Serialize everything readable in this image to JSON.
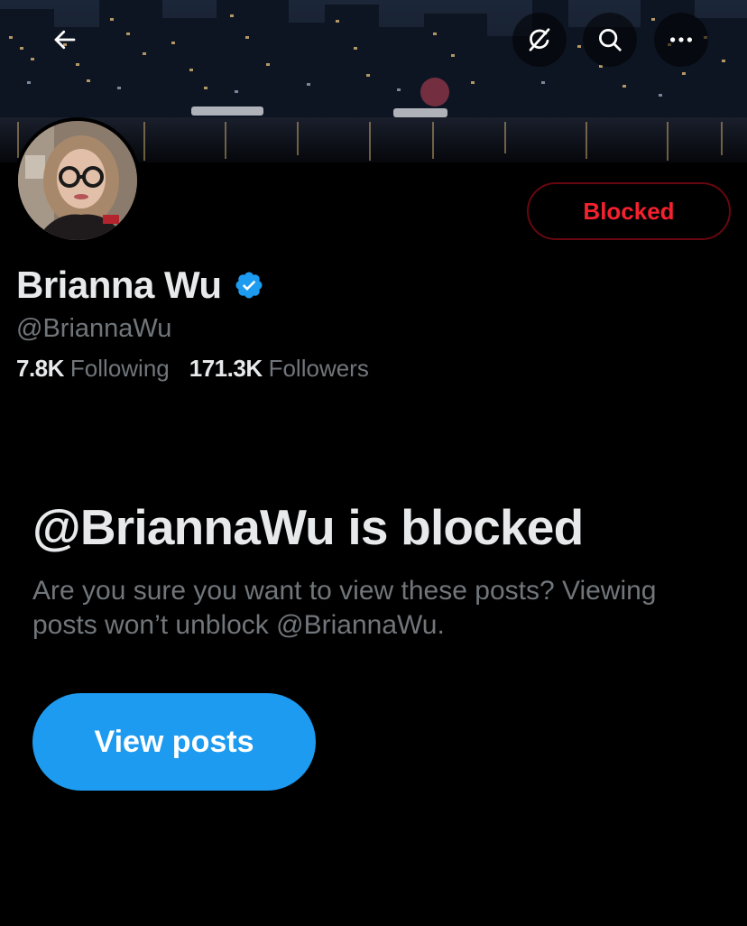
{
  "header": {
    "back_icon": "arrow-left-icon",
    "grok_icon": "grok-icon",
    "search_icon": "search-icon",
    "more_icon": "more-horizontal-icon"
  },
  "profile": {
    "display_name": "Brianna Wu",
    "handle": "@BriannaWu",
    "verified": true,
    "following_count": "7.8K",
    "following_label": "Following",
    "followers_count": "171.3K",
    "followers_label": "Followers",
    "blocked_button_label": "Blocked"
  },
  "blocked_notice": {
    "title": "@BriannaWu is blocked",
    "description": "Are you sure you want to view these posts? Viewing posts won’t unblock @BriannaWu.",
    "view_posts_label": "View posts"
  },
  "colors": {
    "background": "#000000",
    "primary_text": "#e7e9ea",
    "secondary_text": "#71767b",
    "accent_blue": "#1d9bf0",
    "blocked_red": "#f4212e",
    "blocked_border": "#67070f"
  }
}
